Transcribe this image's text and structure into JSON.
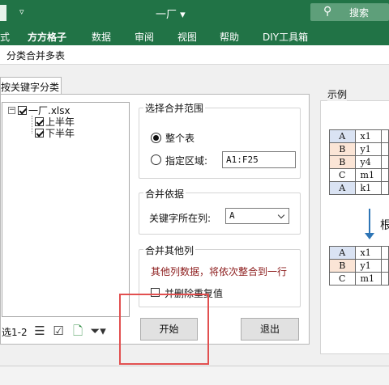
{
  "titlebar": {
    "quick_access": "▿",
    "doc_title": "一厂 ▾",
    "search_label": "搜索"
  },
  "ribbon": {
    "tabs": [
      "式",
      "方方格子",
      "数据",
      "审阅",
      "视图",
      "帮助",
      "DIY工具箱"
    ]
  },
  "dialog": {
    "title": "分类合并多表",
    "tab_label": "按关键字分类",
    "tree": {
      "root": "一厂.xlsx",
      "children": [
        "上半年",
        "下半年"
      ]
    },
    "selection_count": "选1-2",
    "range_group": {
      "title": "选择合并范围",
      "option_whole": "整个表",
      "option_area": "指定区域:",
      "area_value": "A1:F25"
    },
    "basis_group": {
      "title": "合并依据",
      "key_col_label": "关键字所在列:",
      "key_col_value": "A"
    },
    "other_group": {
      "title": "合并其他列",
      "note": "其他列数据，将依次整合到一行",
      "dedupe_label": "并删除重复值"
    },
    "start_button": "开始",
    "exit_button": "退出",
    "example": {
      "title": "示例",
      "side_text": "根",
      "before": [
        [
          "A",
          "x1"
        ],
        [
          "B",
          "y1"
        ],
        [
          "B",
          "y4"
        ],
        [
          "C",
          "m1"
        ],
        [
          "A",
          "k1"
        ]
      ],
      "after": [
        [
          "A",
          "x1"
        ],
        [
          "B",
          "y1"
        ],
        [
          "C",
          "m1"
        ]
      ]
    }
  },
  "colors": {
    "excel_green": "#217346",
    "key_blue": "#dae3f3",
    "key_orange": "#fbe5d6",
    "note_red": "#8b1a1a",
    "highlight_red": "#e25050"
  }
}
